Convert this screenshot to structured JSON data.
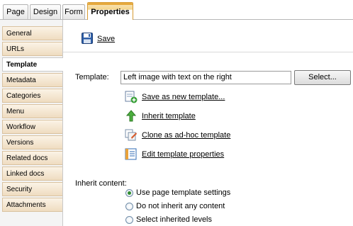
{
  "tabs": [
    {
      "label": "Page"
    },
    {
      "label": "Design"
    },
    {
      "label": "Form"
    },
    {
      "label": "Properties"
    }
  ],
  "sidebar": {
    "items": [
      {
        "label": "General"
      },
      {
        "label": "URLs"
      },
      {
        "label": "Template"
      },
      {
        "label": "Metadata"
      },
      {
        "label": "Categories"
      },
      {
        "label": "Menu"
      },
      {
        "label": "Workflow"
      },
      {
        "label": "Versions"
      },
      {
        "label": "Related docs"
      },
      {
        "label": "Linked docs"
      },
      {
        "label": "Security"
      },
      {
        "label": "Attachments"
      }
    ],
    "active": "Template"
  },
  "toolbar": {
    "save_label": "Save",
    "save_icon": "floppy-disk-icon"
  },
  "template": {
    "label": "Template:",
    "value": "Left image with text on the right",
    "select_label": "Select...",
    "actions": [
      {
        "label": "Save as new template...",
        "icon": "save-template-icon"
      },
      {
        "label": "Inherit template",
        "icon": "green-arrow-up-icon"
      },
      {
        "label": "Clone as ad-hoc template",
        "icon": "clone-template-icon"
      },
      {
        "label": "Edit template properties",
        "icon": "edit-properties-icon"
      }
    ]
  },
  "inherit": {
    "label": "Inherit content:",
    "options": [
      {
        "label": "Use page template settings",
        "checked": true
      },
      {
        "label": "Do not inherit any content",
        "checked": false
      },
      {
        "label": "Select inherited levels",
        "checked": false
      }
    ]
  },
  "colors": {
    "active_tab": "#f3d48a",
    "nav_bg": "#efdcc0",
    "radio_dot": "#2e8b2e"
  }
}
